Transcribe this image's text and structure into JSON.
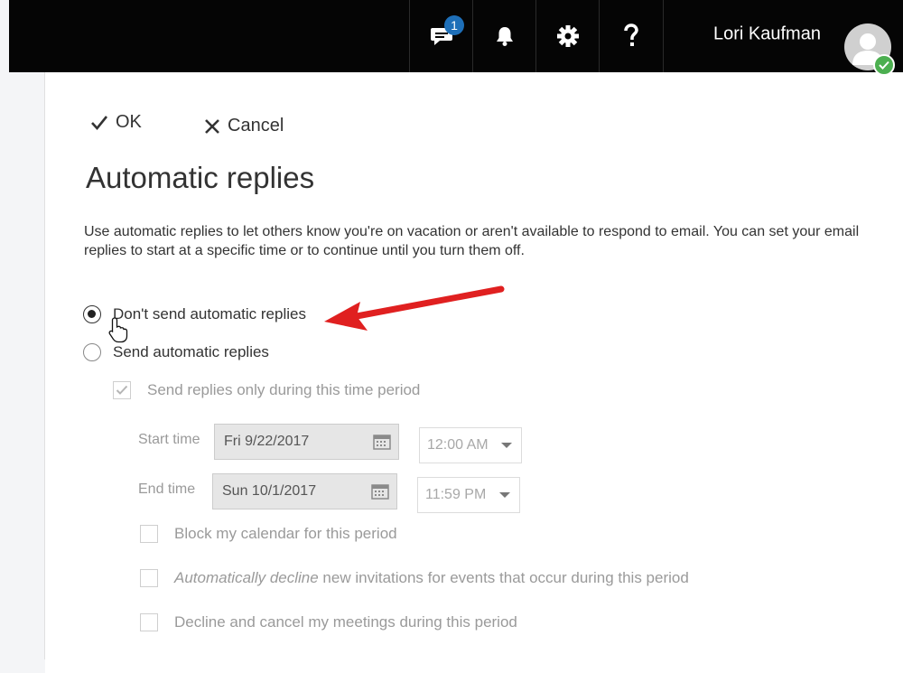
{
  "header": {
    "chat_badge_count": "1",
    "user_name": "Lori Kaufman",
    "icons": [
      "chat-icon",
      "bell-icon",
      "gear-icon",
      "help-icon",
      "avatar-icon",
      "presence-available-icon"
    ]
  },
  "commands": {
    "ok_label": "OK",
    "cancel_label": "Cancel"
  },
  "page": {
    "title": "Automatic replies",
    "description": "Use automatic replies to let others know you're on vacation or aren't available to respond to email. You can set your email replies to start at a specific time or to continue until you turn them off."
  },
  "options": {
    "dont_send_label": "Don't send automatic replies",
    "send_label": "Send automatic replies",
    "selected": "dont_send"
  },
  "time_period": {
    "checkbox_label": "Send replies only during this time period",
    "checked": true,
    "start_label": "Start time",
    "start_date": "Fri 9/22/2017",
    "start_time": "12:00 AM",
    "end_label": "End time",
    "end_date": "Sun 10/1/2017",
    "end_time": "11:59 PM"
  },
  "extras": {
    "block_calendar": "Block my calendar for this period",
    "decline_invites_italic": "Automatically decline",
    "decline_invites_rest": " new invitations for events that occur during this period",
    "cancel_meetings": "Decline and cancel my meetings during this period"
  },
  "colors": {
    "topbar": "#050505",
    "badge": "#1e6fb8",
    "presence": "#4caf50",
    "annotation_arrow": "#e02020"
  }
}
